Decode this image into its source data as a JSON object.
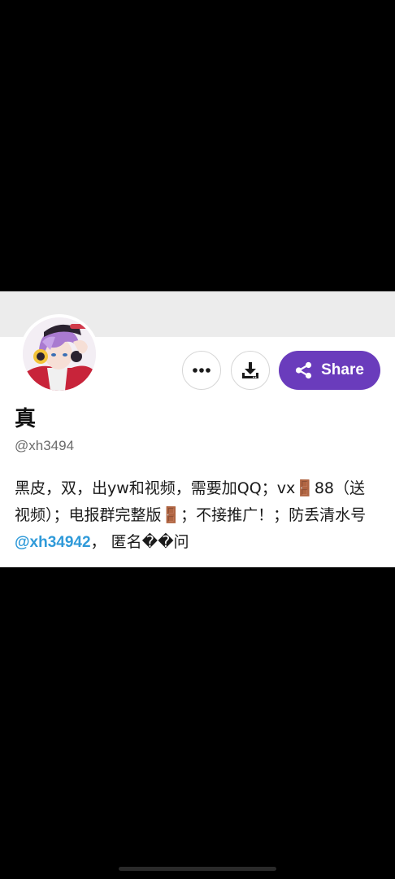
{
  "profile": {
    "display_name": "真",
    "handle": "@xh3494",
    "bio_part1": "黑皮，双，出yw和视频，需要加QQ；vx🚪88（送视频）；电报群完整版🚪；不接推广！；防丢清水号 ",
    "bio_mention": "@xh34942",
    "bio_part2": "， 匿名��问"
  },
  "actions": {
    "more_icon": "more-horizontal-icon",
    "download_icon": "download-icon",
    "share_icon": "share-icon",
    "share_label": "Share"
  },
  "colors": {
    "share_button": "#6a3cbc",
    "mention": "#2f9ad9",
    "banner": "#ececec"
  }
}
